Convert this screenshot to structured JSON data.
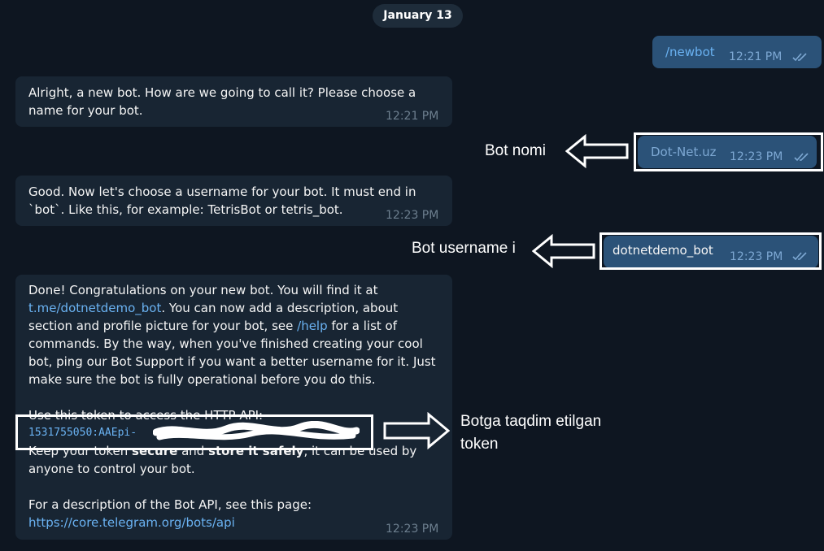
{
  "date_chip": "January 13",
  "messages": {
    "m1": {
      "text": "/newbot",
      "time": "12:21 PM"
    },
    "m2": {
      "line1": "Alright, a new bot. How are we going to call it? Please choose a",
      "line2": "name for your bot.",
      "time": "12:21 PM"
    },
    "m3": {
      "text": "Dot-Net.uz",
      "time": "12:23 PM"
    },
    "m4": {
      "line1": "Good. Now let's choose a username for your bot. It must end in",
      "line2": "`bot`. Like this, for example: TetrisBot or tetris_bot.",
      "time": "12:23 PM"
    },
    "m5": {
      "text": "dotnetdemo_bot",
      "time": "12:23 PM"
    },
    "m6": {
      "p1_line1": "Done! Congratulations on your new bot. You will find it at",
      "p1_link": "t.me/dotnetdemo_bot",
      "p1_line2_rest": ". You can now add a description, about",
      "p1_line3_pre": "section and profile picture for your bot, see ",
      "p1_help": "/help",
      "p1_line3_post": " for a list of",
      "p1_line4": "commands. By the way, when you've finished creating your cool",
      "p1_line5": "bot, ping our Bot Support if you want a better username for it. Just",
      "p1_line6": "make sure the bot is fully operational before you do this.",
      "p2_line1": "Use this token to access the HTTP API:",
      "token": "1531755050:AAEpi-",
      "p2_line3_a": "Keep your token ",
      "p2_secure": "secure",
      "p2_and": " and ",
      "p2_store": "store it safely",
      "p2_line3_b": ", it can be used by",
      "p2_line4": "anyone to control your bot.",
      "p3_line1": "For a description of the Bot API, see this page:",
      "p3_link": "https://core.telegram.org/bots/api",
      "time": "12:23 PM"
    }
  },
  "annotations": {
    "bot_name": "Bot nomi",
    "bot_username": "Bot username i",
    "token_line1": "Botga taqdim etilgan",
    "token_line2": "token"
  },
  "colors": {
    "background": "#0e1621",
    "incoming": "#182533",
    "outgoing": "#2b5278",
    "link": "#6ab2f2"
  }
}
